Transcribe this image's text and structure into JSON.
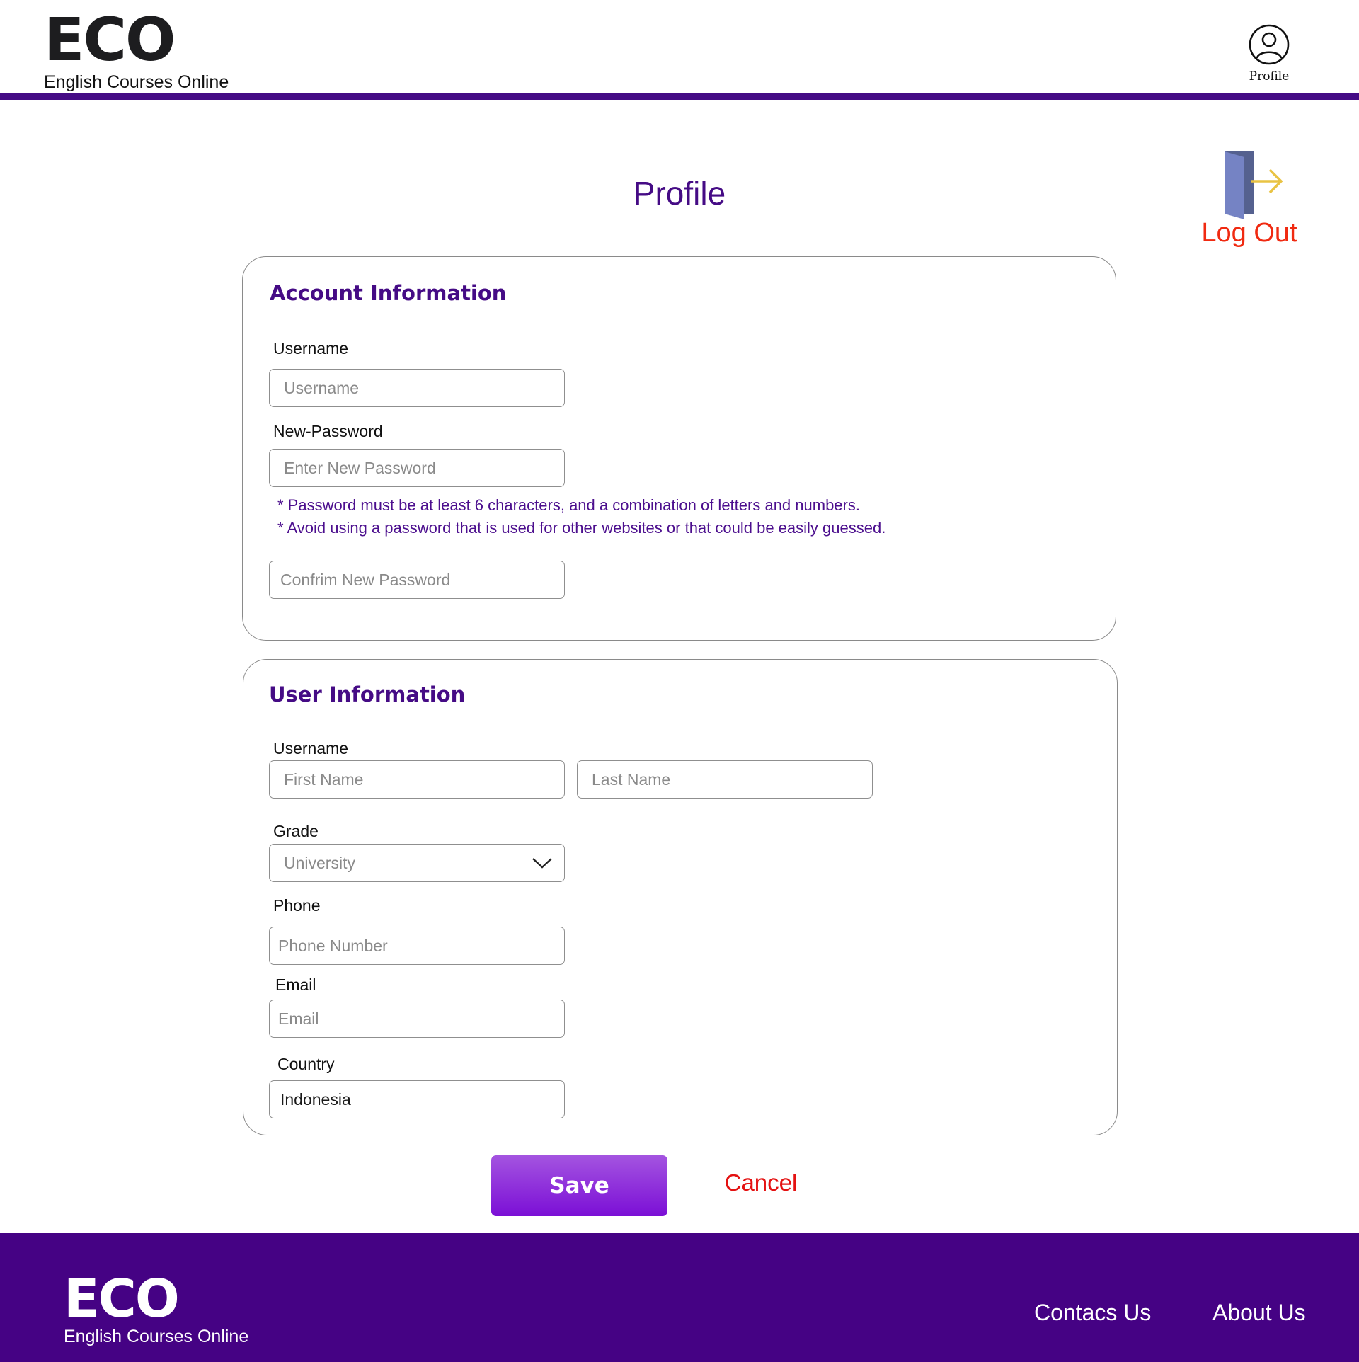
{
  "header": {
    "logo_mark": "ECO",
    "logo_subtitle": "English Courses Online",
    "profile_label": "Profile"
  },
  "page": {
    "title": "Profile",
    "logout_label": "Log Out"
  },
  "account_info": {
    "title": "Account Information",
    "username_label": "Username",
    "username_placeholder": "Username",
    "new_password_label": "New-Password",
    "new_password_placeholder": "Enter New Password",
    "hint_1": "* Password must be at least 6 characters, and a combination of letters and numbers.",
    "hint_2": "* Avoid using a password that is used for other websites or that could be easily guessed.",
    "confirm_password_placeholder": "Confrim  New Password"
  },
  "user_info": {
    "title": "User Information",
    "name_label": "Username",
    "first_name_placeholder": "First Name",
    "last_name_placeholder": "Last Name",
    "grade_label": "Grade",
    "grade_value": "University",
    "phone_label": "Phone",
    "phone_placeholder": "Phone Number",
    "email_label": "Email",
    "email_placeholder": "Email",
    "country_label": "Country",
    "country_value": "Indonesia"
  },
  "actions": {
    "save_label": "Save",
    "cancel_label": "Cancel"
  },
  "footer": {
    "logo_mark": "ECO",
    "logo_subtitle": "English Courses Online",
    "contact_label": "Contacs Us",
    "about_label": "About Us"
  },
  "colors": {
    "brand_purple": "#450b85",
    "logout_red": "#f02a11",
    "cancel_red": "#e41212",
    "save_gradient_top": "#a454e0",
    "save_gradient_bottom": "#7b0fd6"
  },
  "icons": {
    "profile": "user-circle-icon",
    "logout": "door-exit-icon",
    "dropdown": "chevron-down-icon"
  }
}
